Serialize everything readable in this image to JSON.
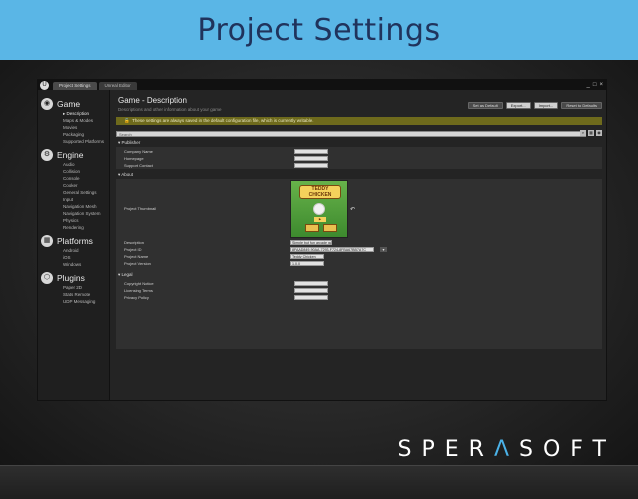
{
  "slide": {
    "title": "Project Settings",
    "logo": {
      "prefix": "SPER",
      "accent": "Λ",
      "suffix": "SOFT"
    }
  },
  "window": {
    "tabs": [
      "Project Settings",
      "Unreal Editor"
    ],
    "controls": [
      "_",
      "□",
      "×"
    ]
  },
  "sidebar": {
    "categories": [
      {
        "label": "Game",
        "items": [
          "Description",
          "Maps & Modes",
          "Movies",
          "Packaging",
          "Supported Platforms"
        ]
      },
      {
        "label": "Engine",
        "items": [
          "Audio",
          "Collision",
          "Console",
          "Cooker",
          "General Settings",
          "Input",
          "Navigation Mesh",
          "Navigation System",
          "Physics",
          "Rendering"
        ]
      },
      {
        "label": "Platforms",
        "items": [
          "Android",
          "iOS",
          "Windows"
        ]
      },
      {
        "label": "Plugins",
        "items": [
          "Paper 2D",
          "Stats Remote",
          "UDP Messaging"
        ]
      }
    ]
  },
  "main": {
    "title": "Game - Description",
    "subtitle": "Descriptions and other information about your game",
    "buttons": [
      "Set as Default",
      "Export...",
      "Import...",
      "Reset to Defaults"
    ],
    "warning": "These settings are always saved in the default configuration file, which is currently writable.",
    "search_placeholder": "Search",
    "sections": {
      "publisher": {
        "label": "Publisher",
        "rows": [
          "Company Name",
          "Homepage",
          "Support Contact"
        ]
      },
      "about": {
        "label": "About",
        "thumbnail_label": "Project Thumbnail",
        "thumbnail_title": "TEDDY CHICKEN",
        "rows": [
          {
            "label": "Description",
            "value": "Simple but fun arcade game"
          },
          {
            "label": "Project ID",
            "value": "8FAAD849-90AA-7293-F724-8FBA67BB7A7C"
          },
          {
            "label": "Project Name",
            "value": "Teddy Chicken"
          },
          {
            "label": "Project Version",
            "value": "1.0.0"
          }
        ]
      },
      "legal": {
        "label": "Legal",
        "rows": [
          "Copyright Notice",
          "Licensing Terms",
          "Privacy Policy"
        ]
      }
    }
  }
}
